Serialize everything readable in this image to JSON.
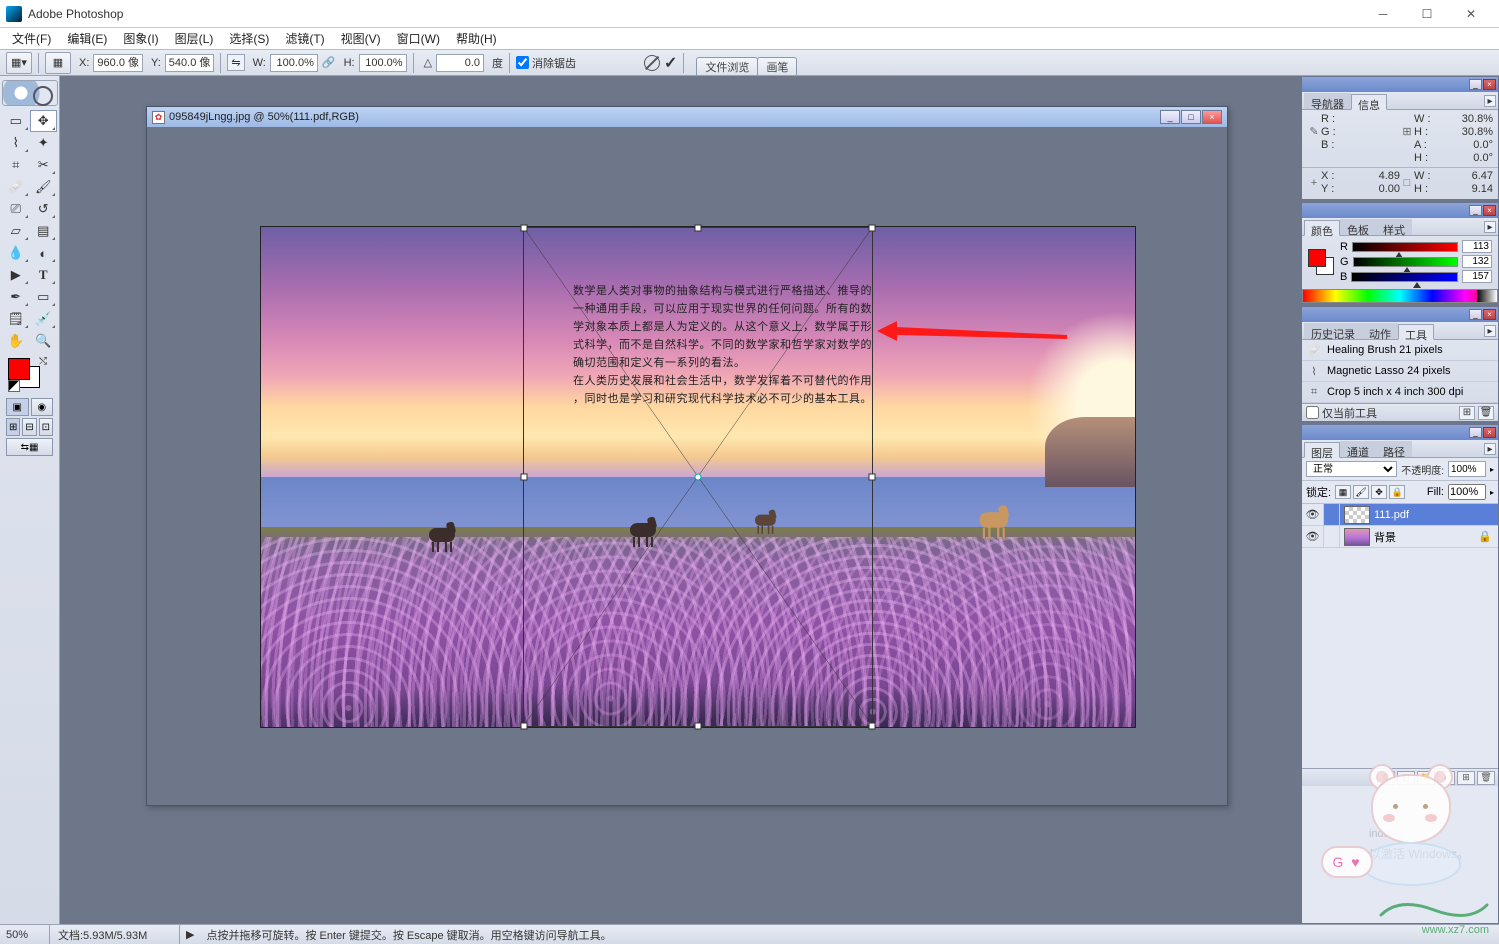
{
  "app": {
    "title": "Adobe Photoshop"
  },
  "menu": {
    "file": "文件(F)",
    "edit": "编辑(E)",
    "image": "图象(I)",
    "layer": "图层(L)",
    "select": "选择(S)",
    "filter": "滤镜(T)",
    "view": "视图(V)",
    "window": "窗口(W)",
    "help": "帮助(H)"
  },
  "options": {
    "x_label": "X:",
    "x_val": "960.0 像",
    "y_label": "Y:",
    "y_val": "540.0 像",
    "w_label": "W:",
    "w_val": "100.0%",
    "h_label": "H:",
    "h_val": "100.0%",
    "angle_label": "△",
    "angle_val": "0.0",
    "angle_unit": "度",
    "antialias": "消除锯齿",
    "tabs": {
      "files": "文件浏览",
      "brush": "画笔"
    }
  },
  "document": {
    "title": "095849jLngg.jpg @ 50%(111.pdf,RGB)",
    "zoom": "50%",
    "size_info": "文档:5.93M/5.93M",
    "hint": "点按并拖移可旋转。按 Enter 键提交。按 Escape 键取消。用空格键访问导航工具。",
    "overlay_text_lines": [
      "数学是人类对事物的抽象结构与模式进行严格描述、推导的",
      "一种通用手段，可以应用于现实世界的任何问题。所有的数",
      "学对象本质上都是人为定义的。从这个意义上，数学属于形",
      "式科学，而不是自然科学。不同的数学家和哲学家对数学的",
      "确切范围和定义有一系列的看法。",
      "在人类历史发展和社会生活中，数学发挥着不可替代的作用",
      "，同时也是学习和研究现代科学技术必不可少的基本工具。"
    ]
  },
  "panels": {
    "navigator_tab": "导航器",
    "info_tab": "信息",
    "info": {
      "r": "R :",
      "g": "G :",
      "b": "B :",
      "w": "W :",
      "w_val": "30.8%",
      "h": "H :",
      "h_val": "30.8%",
      "a": "A :",
      "a_val": "0.0°",
      "h2": "H :",
      "h2_val": "0.0°",
      "x": "X :",
      "x_val": "4.89",
      "y": "Y :",
      "y_val": "0.00",
      "w2": "W :",
      "w2_val": "6.47",
      "h3": "H :",
      "h3_val": "9.14"
    },
    "color_tab": "颜色",
    "swatch_tab": "色板",
    "style_tab": "样式",
    "color": {
      "r_label": "R",
      "r_val": "113",
      "g_label": "G",
      "g_val": "132",
      "b_label": "B",
      "b_val": "157"
    },
    "history_tab": "历史记录",
    "actions_tab": "动作",
    "tools_tab": "工具",
    "history": {
      "item1": "Healing Brush 21 pixels",
      "item2": "Magnetic Lasso 24 pixels",
      "item3": "Crop 5 inch x 4 inch 300 dpi",
      "footer_check": "仅当前工具"
    },
    "layers_tab": "图层",
    "channels_tab": "通道",
    "paths_tab": "路径",
    "layers": {
      "blend_mode": "正常",
      "opacity_label": "不透明度:",
      "opacity_val": "100%",
      "lock_label": "锁定:",
      "fill_label": "Fill:",
      "fill_val": "100%",
      "layer1_name": "111.pdf",
      "layer2_name": "背景"
    }
  },
  "activate": {
    "line1": "indows",
    "line2": "以激活 Windows。"
  },
  "watermark": {
    "brand": "",
    "url": "www.xz7.com"
  },
  "mascot_badge": "G ♥"
}
